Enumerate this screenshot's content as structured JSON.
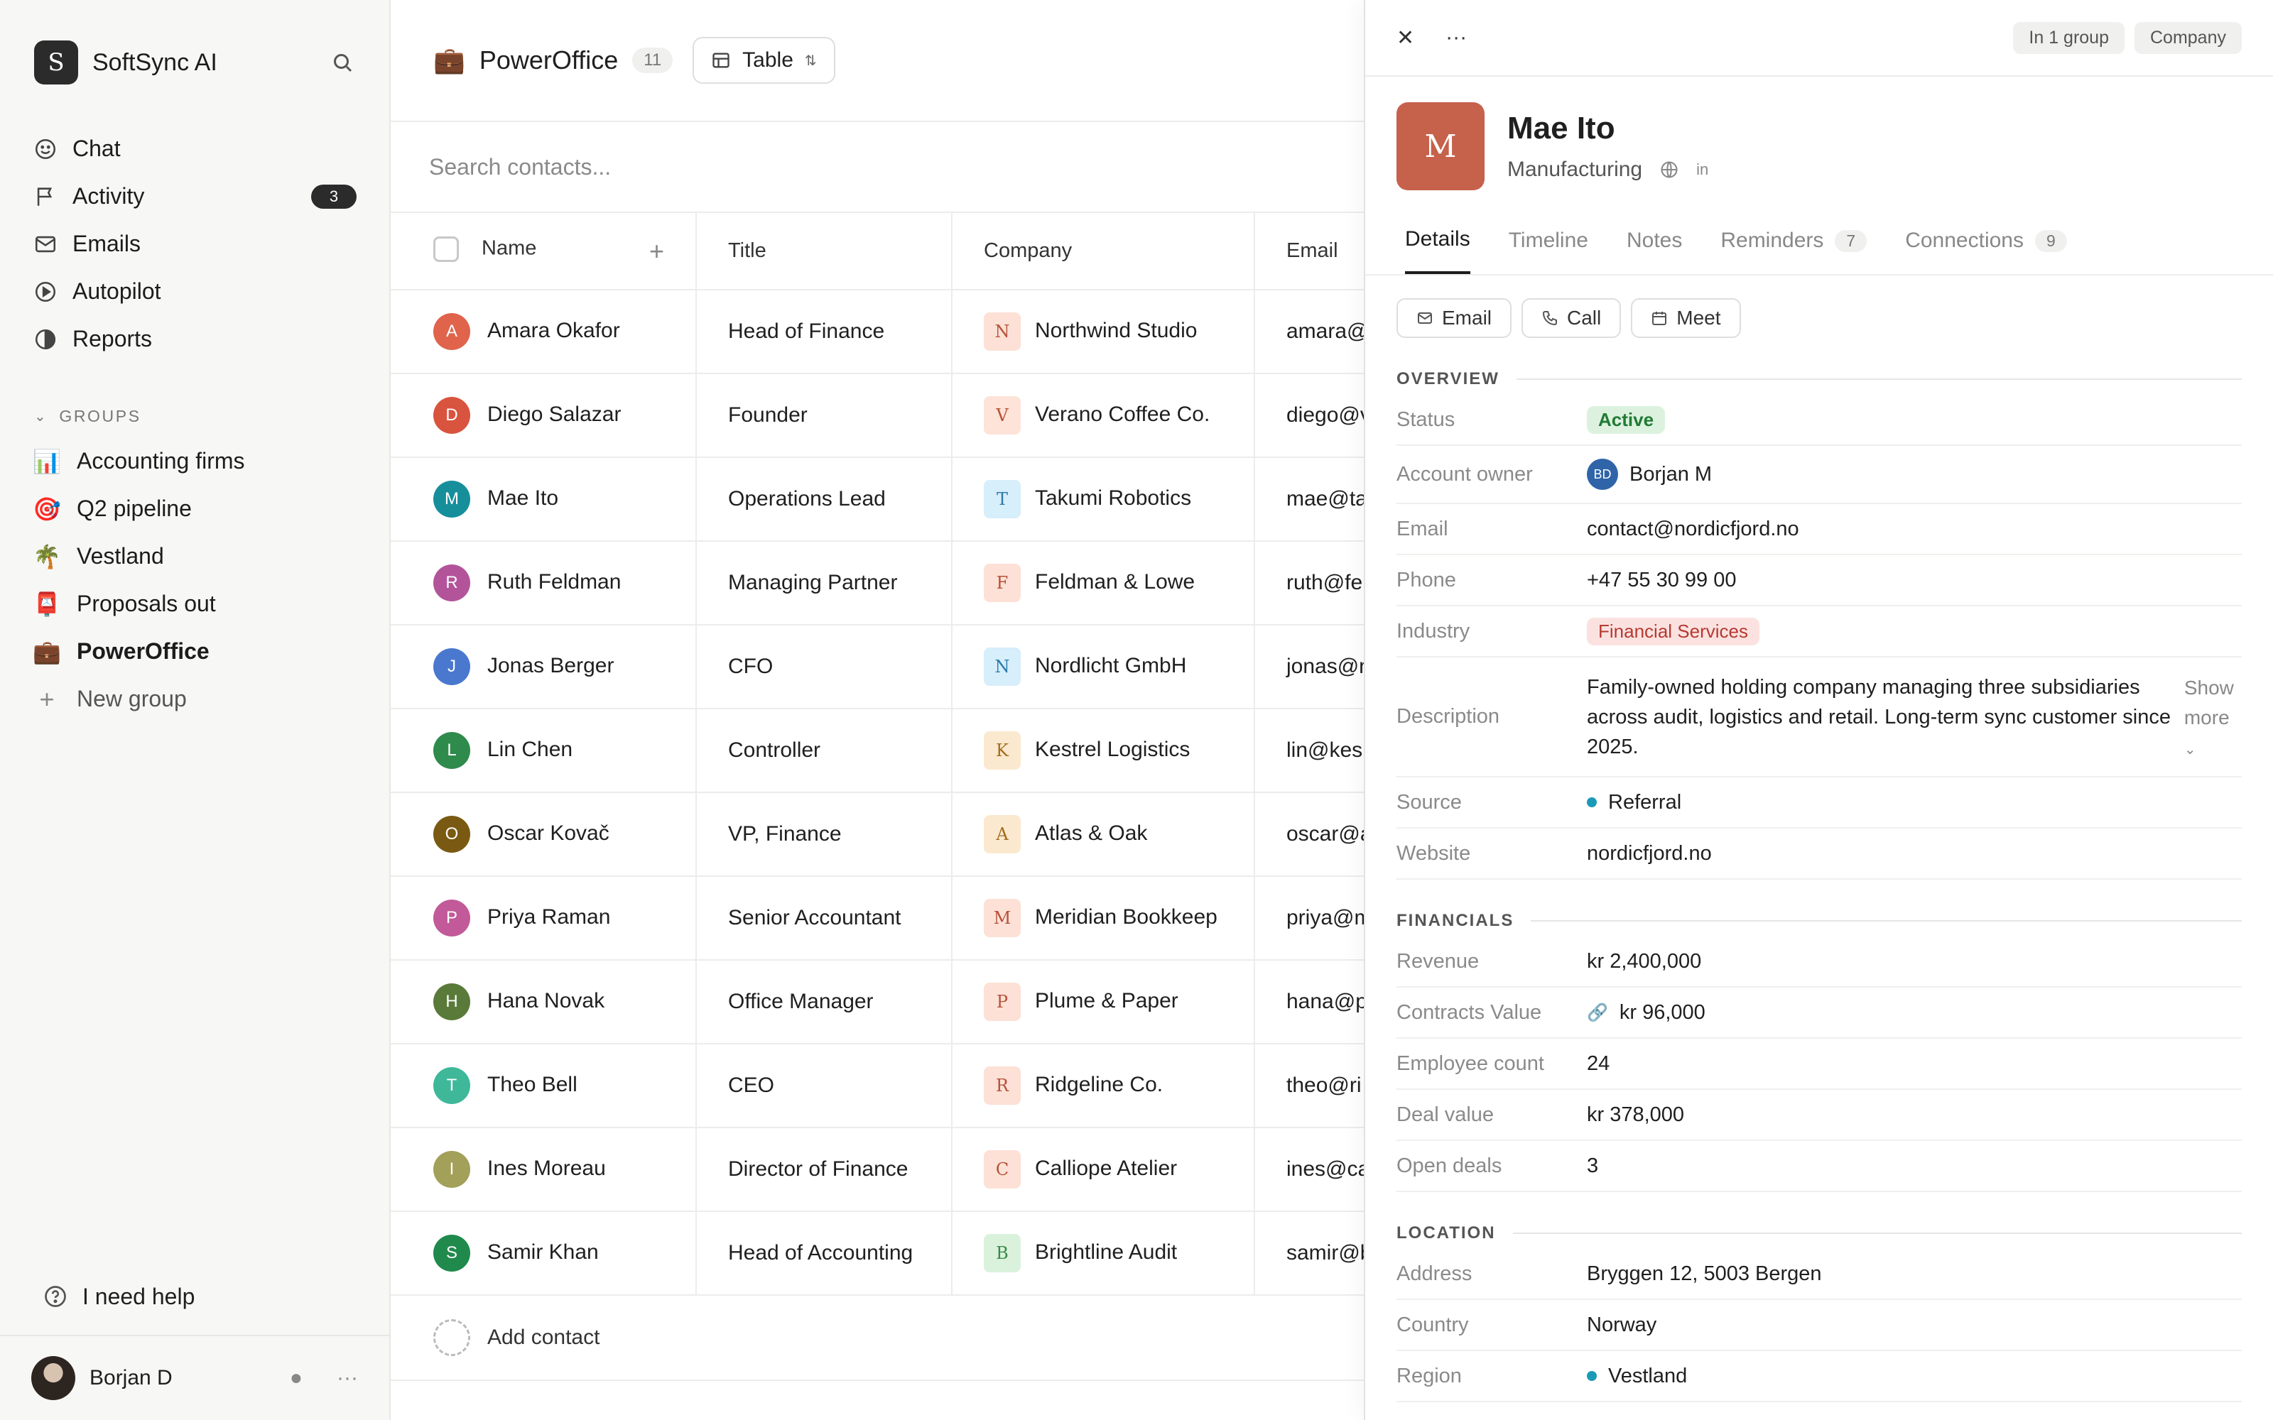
{
  "brand": {
    "logo_letter": "S",
    "name": "SoftSync AI"
  },
  "nav": [
    {
      "label": "Chat",
      "icon": "smile-icon"
    },
    {
      "label": "Activity",
      "icon": "flag-icon",
      "badge": "3"
    },
    {
      "label": "Emails",
      "icon": "mail-icon"
    },
    {
      "label": "Autopilot",
      "icon": "play-circle-icon"
    },
    {
      "label": "Reports",
      "icon": "half-circle-icon"
    }
  ],
  "groups": {
    "label": "GROUPS",
    "items": [
      {
        "emoji": "📊",
        "label": "Accounting firms"
      },
      {
        "emoji": "🎯",
        "label": "Q2 pipeline"
      },
      {
        "emoji": "🌴",
        "label": "Vestland"
      },
      {
        "emoji": "📮",
        "label": "Proposals out"
      },
      {
        "emoji": "💼",
        "label": "PowerOffice"
      }
    ],
    "new_group": "New group"
  },
  "help": "I need help",
  "user": {
    "name": "Borjan D"
  },
  "header": {
    "emoji": "💼",
    "title": "PowerOffice",
    "count": "11",
    "view": "Table"
  },
  "search": {
    "placeholder": "Search contacts..."
  },
  "table": {
    "columns": [
      "Name",
      "Title",
      "Company",
      "Email"
    ],
    "rows": [
      {
        "initial": "A",
        "color": "#e0634c",
        "name": "Amara Okafor",
        "title": "Head of Finance",
        "co_letter": "N",
        "co_bg": "#fde1d6",
        "co_fg": "#b5523a",
        "company": "Northwind Studio",
        "email": "amara@"
      },
      {
        "initial": "D",
        "color": "#d9543f",
        "name": "Diego Salazar",
        "title": "Founder",
        "co_letter": "V",
        "co_bg": "#fde3d8",
        "co_fg": "#b5523a",
        "company": "Verano Coffee Co.",
        "email": "diego@v"
      },
      {
        "initial": "M",
        "color": "#168f9b",
        "name": "Mae Ito",
        "title": "Operations Lead",
        "co_letter": "T",
        "co_bg": "#d7eefb",
        "co_fg": "#2a7aa8",
        "company": "Takumi Robotics",
        "email": "mae@ta"
      },
      {
        "initial": "R",
        "color": "#b3549b",
        "name": "Ruth Feldman",
        "title": "Managing Partner",
        "co_letter": "F",
        "co_bg": "#fde1d6",
        "co_fg": "#b5523a",
        "company": "Feldman & Lowe",
        "email": "ruth@fe"
      },
      {
        "initial": "J",
        "color": "#4a78cf",
        "name": "Jonas Berger",
        "title": "CFO",
        "co_letter": "N",
        "co_bg": "#d7eefb",
        "co_fg": "#2a7aa8",
        "company": "Nordlicht GmbH",
        "email": "jonas@n"
      },
      {
        "initial": "L",
        "color": "#2e8b4c",
        "name": "Lin Chen",
        "title": "Controller",
        "co_letter": "K",
        "co_bg": "#fbe9cf",
        "co_fg": "#a36d1e",
        "company": "Kestrel Logistics",
        "email": "lin@kes"
      },
      {
        "initial": "O",
        "color": "#7a5a12",
        "name": "Oscar Kovač",
        "title": "VP, Finance",
        "co_letter": "A",
        "co_bg": "#fbe9cf",
        "co_fg": "#a36d1e",
        "company": "Atlas & Oak",
        "email": "oscar@a"
      },
      {
        "initial": "P",
        "color": "#c25a9a",
        "name": "Priya Raman",
        "title": "Senior Accountant",
        "co_letter": "M",
        "co_bg": "#fde1d6",
        "co_fg": "#b5523a",
        "company": "Meridian Bookkeep",
        "email": "priya@m"
      },
      {
        "initial": "H",
        "color": "#5a7a3a",
        "name": "Hana Novak",
        "title": "Office Manager",
        "co_letter": "P",
        "co_bg": "#fde1d6",
        "co_fg": "#b5523a",
        "company": "Plume & Paper",
        "email": "hana@p"
      },
      {
        "initial": "T",
        "color": "#3fb89a",
        "name": "Theo Bell",
        "title": "CEO",
        "co_letter": "R",
        "co_bg": "#fde1d6",
        "co_fg": "#b5523a",
        "company": "Ridgeline Co.",
        "email": "theo@ri"
      },
      {
        "initial": "I",
        "color": "#a3a05a",
        "name": "Ines Moreau",
        "title": "Director of Finance",
        "co_letter": "C",
        "co_bg": "#fde1d6",
        "co_fg": "#b5523a",
        "company": "Calliope Atelier",
        "email": "ines@ca"
      },
      {
        "initial": "S",
        "color": "#1f8a4c",
        "name": "Samir Khan",
        "title": "Head of Accounting",
        "co_letter": "B",
        "co_bg": "#daf2dc",
        "co_fg": "#3a8a4a",
        "company": "Brightline Audit",
        "email": "samir@b"
      }
    ],
    "add_label": "Add contact"
  },
  "panel": {
    "chips": [
      "In 1 group",
      "Company"
    ],
    "avatar_letter": "M",
    "name": "Mae Ito",
    "industry_sub": "Manufacturing",
    "linkedin": "in",
    "tabs": [
      {
        "label": "Details"
      },
      {
        "label": "Timeline"
      },
      {
        "label": "Notes"
      },
      {
        "label": "Reminders",
        "count": "7"
      },
      {
        "label": "Connections",
        "count": "9"
      }
    ],
    "actions": [
      {
        "label": "Email",
        "icon": "mail-icon"
      },
      {
        "label": "Call",
        "icon": "phone-icon"
      },
      {
        "label": "Meet",
        "icon": "calendar-icon"
      }
    ],
    "overview": {
      "title": "OVERVIEW",
      "status_label": "Status",
      "status": "Active",
      "owner_label": "Account owner",
      "owner_initials": "BD",
      "owner": "Borjan M",
      "email_label": "Email",
      "email": "contact@nordicfjord.no",
      "phone_label": "Phone",
      "phone": "+47 55 30 99 00",
      "industry_label": "Industry",
      "industry": "Financial Services",
      "description_label": "Description",
      "description": "Family-owned holding company managing three subsidiaries across audit, logistics and retail. Long-term sync customer since 2025.",
      "show_more": "Show more",
      "source_label": "Source",
      "source": "Referral",
      "website_label": "Website",
      "website": "nordicfjord.no"
    },
    "financials": {
      "title": "FINANCIALS",
      "revenue_label": "Revenue",
      "revenue": "kr 2,400,000",
      "contracts_label": "Contracts Value",
      "contracts": "kr 96,000",
      "employees_label": "Employee count",
      "employees": "24",
      "deal_label": "Deal value",
      "deal": "kr 378,000",
      "open_label": "Open deals",
      "open": "3"
    },
    "location": {
      "title": "LOCATION",
      "address_label": "Address",
      "address": "Bryggen 12, 5003 Bergen",
      "country_label": "Country",
      "country": "Norway",
      "region_label": "Region",
      "region": "Vestland"
    }
  }
}
